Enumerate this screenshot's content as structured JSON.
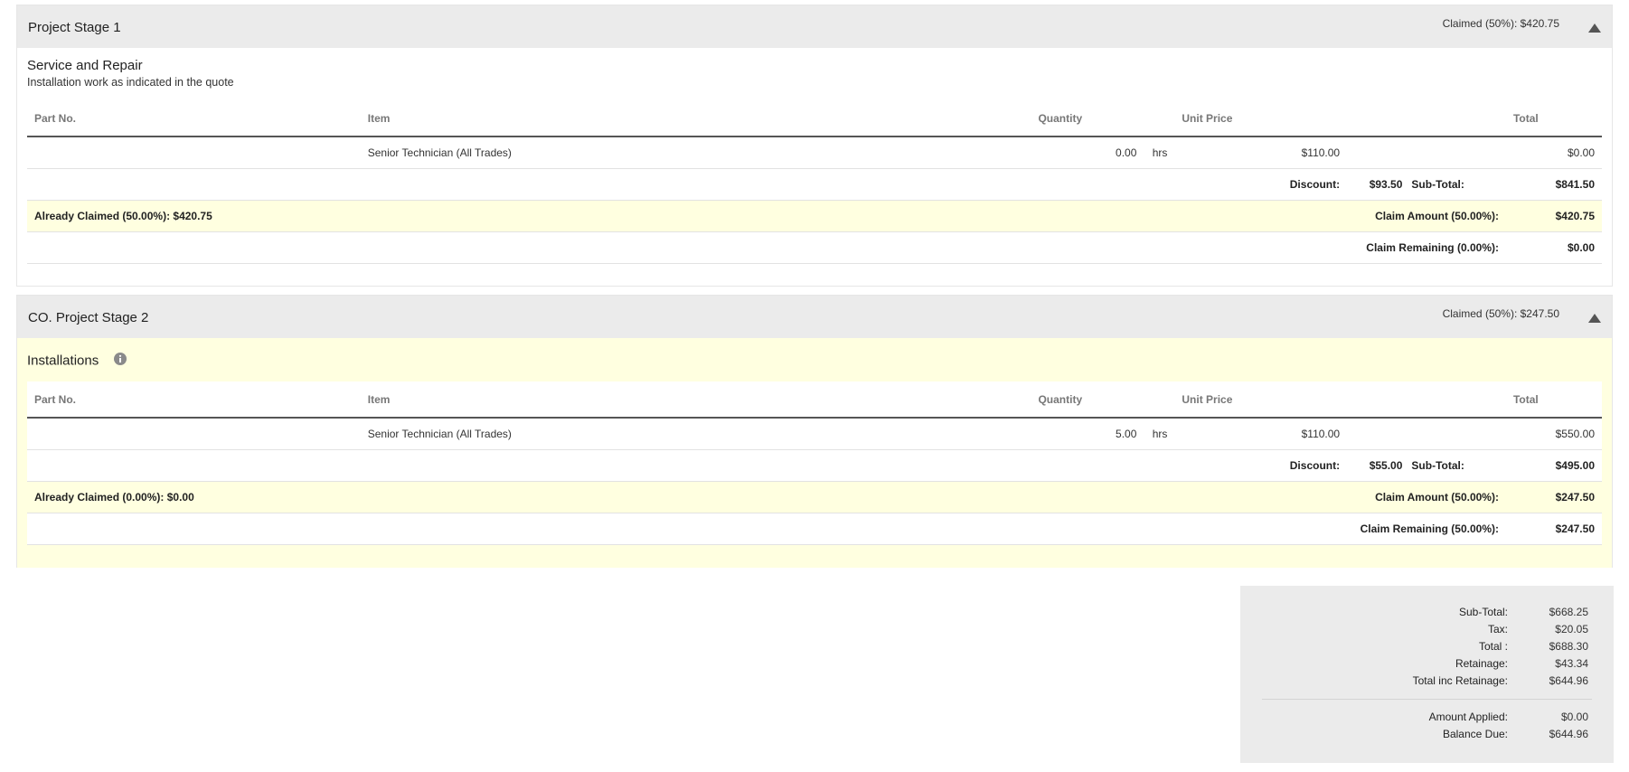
{
  "stage1": {
    "title": "Project Stage 1",
    "claimed": "Claimed (50%): $420.75",
    "section_title": "Service and Repair",
    "section_desc": "Installation work as indicated in the quote",
    "headers": {
      "part_no": "Part No.",
      "item": "Item",
      "quantity": "Quantity",
      "unit_price": "Unit Price",
      "total": "Total"
    },
    "row": {
      "part_no": "",
      "item": "Senior Technician (All Trades)",
      "quantity": "0.00",
      "unit": "hrs",
      "unit_price": "$110.00",
      "total": "$0.00"
    },
    "discount_label": "Discount:",
    "discount_value": "$93.50",
    "subtotal_label": "Sub-Total:",
    "subtotal_value": "$841.50",
    "already_claimed": "Already Claimed (50.00%): $420.75",
    "claim_amount_label": "Claim Amount (50.00%):",
    "claim_amount_value": "$420.75",
    "claim_remaining_label": "Claim Remaining (0.00%):",
    "claim_remaining_value": "$0.00"
  },
  "stage2": {
    "title": "CO. Project Stage 2",
    "claimed": "Claimed (50%): $247.50",
    "section_title": "Installations",
    "headers": {
      "part_no": "Part No.",
      "item": "Item",
      "quantity": "Quantity",
      "unit_price": "Unit Price",
      "total": "Total"
    },
    "row": {
      "part_no": "",
      "item": "Senior Technician (All Trades)",
      "quantity": "5.00",
      "unit": "hrs",
      "unit_price": "$110.00",
      "total": "$550.00"
    },
    "discount_label": "Discount:",
    "discount_value": "$55.00",
    "subtotal_label": "Sub-Total:",
    "subtotal_value": "$495.00",
    "already_claimed": "Already Claimed (0.00%): $0.00",
    "claim_amount_label": "Claim Amount (50.00%):",
    "claim_amount_value": "$247.50",
    "claim_remaining_label": "Claim Remaining (50.00%):",
    "claim_remaining_value": "$247.50"
  },
  "totals": {
    "subtotal_label": "Sub-Total:",
    "subtotal_value": "$668.25",
    "tax_label": "Tax:",
    "tax_value": "$20.05",
    "total_label": "Total :",
    "total_value": "$688.30",
    "retainage_label": "Retainage:",
    "retainage_value": "$43.34",
    "total_inc_retainage_label": "Total inc Retainage:",
    "total_inc_retainage_value": "$644.96",
    "amount_applied_label": "Amount Applied:",
    "amount_applied_value": "$0.00",
    "balance_due_label": "Balance Due:",
    "balance_due_value": "$644.96"
  },
  "colors": {
    "header_bg": "#ebebeb",
    "highlight_bg": "#ffffe0",
    "icon": "#8a8a8a"
  },
  "icons": {
    "collapse": "triangle-up-icon",
    "info": "info-circle-icon"
  }
}
